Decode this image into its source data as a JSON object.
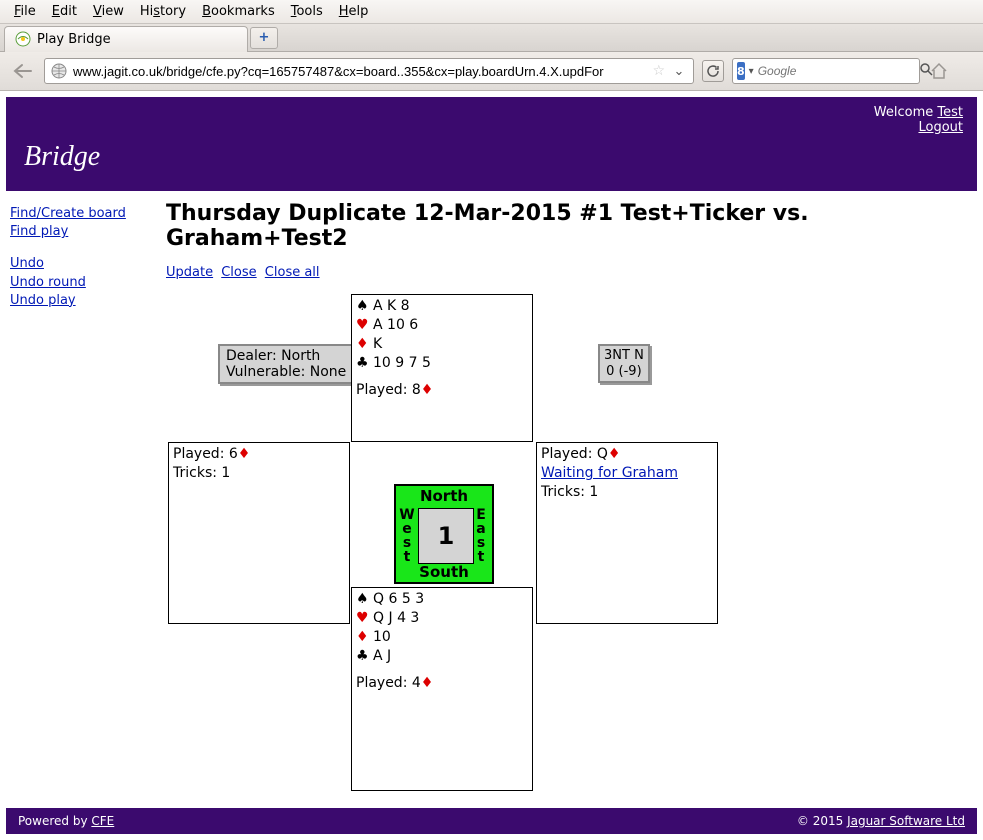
{
  "menubar": [
    "File",
    "Edit",
    "View",
    "History",
    "Bookmarks",
    "Tools",
    "Help"
  ],
  "tab": {
    "title": "Play Bridge"
  },
  "url": "www.jagit.co.uk/bridge/cfe.py?cq=165757487&cx=board..355&cx=play.boardUrn.4.X.updFor",
  "search": {
    "placeholder": "Google"
  },
  "banner": {
    "brand": "Bridge",
    "welcome_prefix": "Welcome ",
    "user": "Test",
    "logout": "Logout"
  },
  "sidebar": {
    "find_board": "Find/Create board",
    "find_play": "Find play",
    "undo": "Undo",
    "undo_round": "Undo round",
    "undo_play": "Undo play"
  },
  "title": "Thursday Duplicate 12-Mar-2015 #1 Test+Ticker vs. Graham+Test2",
  "actions": {
    "update": "Update",
    "close": "Close",
    "close_all": "Close all"
  },
  "info": {
    "dealer": "Dealer: North",
    "vuln": "Vulnerable: None"
  },
  "contract": {
    "line1": "3NT N",
    "line2": "0 (-9)"
  },
  "compass": {
    "n": "North",
    "s": "South",
    "w": "West",
    "e": "East",
    "num": "1"
  },
  "hands": {
    "north": {
      "spades": "A K 8",
      "hearts": "A 10 6",
      "diamonds": "K",
      "clubs": "10 9 7 5",
      "played_label": "Played: ",
      "played_card": "8",
      "played_suit": "diamond"
    },
    "west": {
      "played_label": "Played: ",
      "played_card": "6",
      "played_suit": "diamond",
      "tricks": "Tricks: 1"
    },
    "east": {
      "played_label": "Played: ",
      "played_card": "Q",
      "played_suit": "diamond",
      "waiting": "Waiting for Graham",
      "tricks": "Tricks: 1"
    },
    "south": {
      "spades": "Q 6 5 3",
      "hearts": "Q J 4 3",
      "diamonds": "10",
      "clubs": "A J",
      "played_label": "Played: ",
      "played_card": "4",
      "played_suit": "diamond"
    }
  },
  "footer": {
    "powered": "Powered by ",
    "cfe": "CFE",
    "copyright": "©  2015 ",
    "company": "Jaguar Software Ltd"
  }
}
